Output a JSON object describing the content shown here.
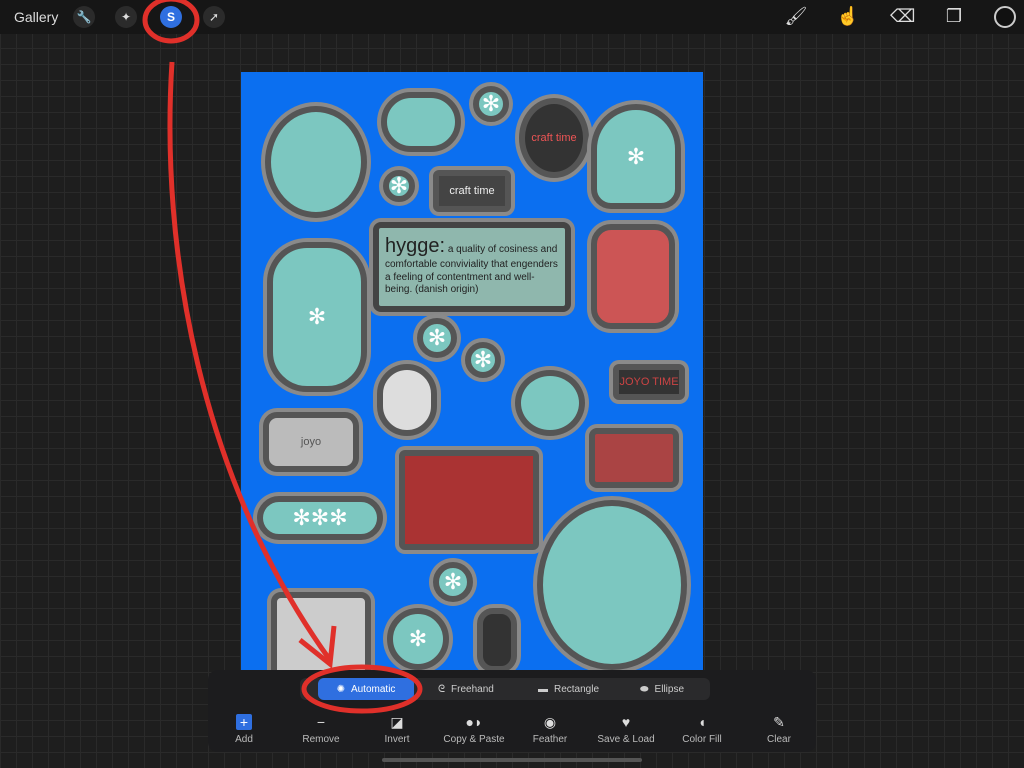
{
  "topbar": {
    "gallery": "Gallery",
    "left_icons": [
      "wrench-icon",
      "magic-wand-icon",
      "selection-icon",
      "transform-arrow-icon"
    ],
    "selection_glyph": "S",
    "right_icons": [
      "brush-icon",
      "smudge-icon",
      "eraser-icon",
      "layers-icon",
      "color-well"
    ]
  },
  "canvas": {
    "background": "#0b6ff0",
    "hygge_word": "hygge:",
    "hygge_text": "a quality of cosiness and comfortable conviviality that engenders a feeling of contentment and well-being.",
    "hygge_origin": "(danish origin)",
    "craft_time": "craft time",
    "joyo": "joyo",
    "joyo_time": "JOYO TIME"
  },
  "selection": {
    "modes": [
      {
        "label": "Automatic",
        "active": true
      },
      {
        "label": "Freehand"
      },
      {
        "label": "Rectangle"
      },
      {
        "label": "Ellipse"
      }
    ],
    "tools": [
      {
        "label": "Add",
        "icon": "+"
      },
      {
        "label": "Remove",
        "icon": "−"
      },
      {
        "label": "Invert",
        "icon": "◪"
      },
      {
        "label": "Copy & Paste",
        "icon": "●◗"
      },
      {
        "label": "Feather",
        "icon": "◉"
      },
      {
        "label": "Save & Load",
        "icon": "♥"
      },
      {
        "label": "Color Fill",
        "icon": "◖"
      },
      {
        "label": "Clear",
        "icon": "✎"
      }
    ]
  },
  "colors": {
    "accent": "#2f6fe0",
    "annotation": "#e0302a"
  }
}
